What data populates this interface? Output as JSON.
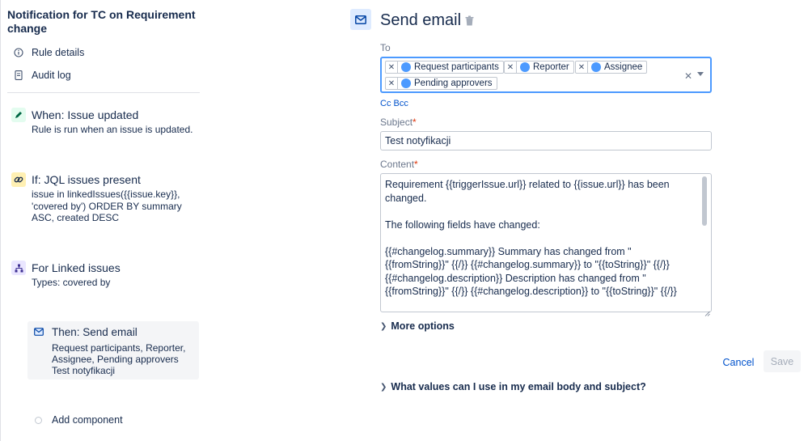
{
  "rule": {
    "title": "Notification for TC on Requirement change",
    "nav": [
      {
        "label": "Rule details",
        "icon": "info-icon"
      },
      {
        "label": "Audit log",
        "icon": "document-icon"
      }
    ]
  },
  "steps": {
    "when": {
      "title": "When: Issue updated",
      "desc": "Rule is run when an issue is updated.",
      "icon": "pencil-icon",
      "color": "#E3FCEF"
    },
    "if": {
      "title": "If: JQL issues present",
      "desc": "issue in linkedIssues({{issue.key}}, 'covered by') ORDER BY summary ASC, created DESC",
      "icon": "link-icon",
      "color": "#FFF0B3"
    },
    "branch": {
      "title": "For Linked issues",
      "desc": "Types: covered by",
      "icon": "hierarchy-icon",
      "color": "#EAE6FF"
    },
    "then": {
      "title": "Then: Send email",
      "lines": [
        "Request participants, Reporter,",
        "Assignee, Pending approvers",
        "Test notyfikacji"
      ],
      "icon": "email-icon"
    },
    "add_component": "Add component"
  },
  "action": {
    "title": "Send email",
    "to_label": "To",
    "recipients": [
      "Request participants",
      "Reporter",
      "Assignee",
      "Pending approvers"
    ],
    "cc_bcc": "Cc Bcc",
    "subject_label": "Subject",
    "required_mark": "*",
    "subject_value": "Test notyfikacji",
    "content_label": "Content",
    "content_lines": [
      "Requirement {{triggerIssue.url}}  related to {{issue.url}} has been changed.",
      "",
      "The following fields have changed:",
      "",
      "{{#changelog.summary}} Summary has changed from \" {{fromString}}\" {{/}} {{#changelog.summary}} to \"{{toString}}\" {{/}} {{#changelog.description}} Description has changed from \" {{fromString}}\" {{/}}  {{#changelog.description}} to \"{{toString}}\" {{/}}"
    ],
    "more_options": "More options",
    "cancel": "Cancel",
    "save": "Save",
    "help": "What values can I use in my email body and subject?"
  },
  "colors": {
    "accent": "#0052CC",
    "focus_border": "#4C9AFF",
    "required": "#DE350B"
  }
}
